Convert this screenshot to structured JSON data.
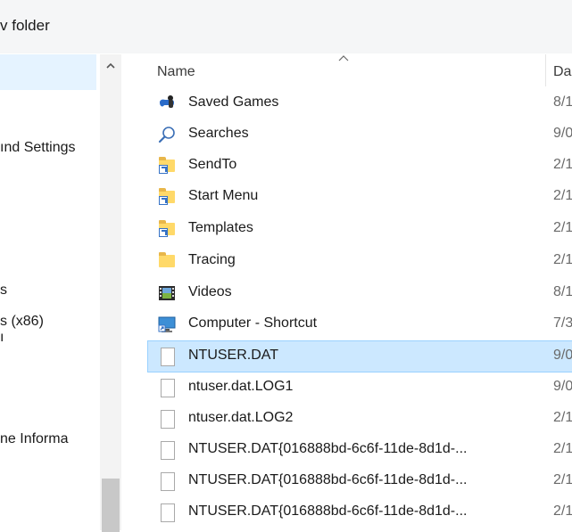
{
  "toolbar": {
    "new_folder": "v folder"
  },
  "nav": {
    "items": [
      {
        "label": ""
      },
      {
        "label": "ınd Settings"
      },
      {
        "label": "s"
      },
      {
        "label": "s (x86)"
      },
      {
        "label": "ı"
      },
      {
        "label": "ne Informa"
      }
    ]
  },
  "list": {
    "columns": {
      "name": "Name",
      "date": "Da"
    },
    "rows": [
      {
        "name": "Saved Games",
        "date": "8/1",
        "icon": "saved-games-icon"
      },
      {
        "name": "Searches",
        "date": "9/0",
        "icon": "search-icon"
      },
      {
        "name": "SendTo",
        "date": "2/1",
        "icon": "folder-shortcut-icon"
      },
      {
        "name": "Start Menu",
        "date": "2/1",
        "icon": "folder-shortcut-icon"
      },
      {
        "name": "Templates",
        "date": "2/1",
        "icon": "folder-shortcut-icon"
      },
      {
        "name": "Tracing",
        "date": "2/1",
        "icon": "folder-icon"
      },
      {
        "name": "Videos",
        "date": "8/1",
        "icon": "videos-icon"
      },
      {
        "name": "Computer - Shortcut",
        "date": "7/3",
        "icon": "computer-shortcut-icon"
      },
      {
        "name": "NTUSER.DAT",
        "date": "9/0",
        "icon": "file-icon",
        "selected": true
      },
      {
        "name": "ntuser.dat.LOG1",
        "date": "9/0",
        "icon": "file-icon"
      },
      {
        "name": "ntuser.dat.LOG2",
        "date": "2/1",
        "icon": "file-icon"
      },
      {
        "name": "NTUSER.DAT{016888bd-6c6f-11de-8d1d-...",
        "date": "2/1",
        "icon": "file-icon"
      },
      {
        "name": "NTUSER.DAT{016888bd-6c6f-11de-8d1d-...",
        "date": "2/1",
        "icon": "file-icon"
      },
      {
        "name": "NTUSER.DAT{016888bd-6c6f-11de-8d1d-...",
        "date": "2/1",
        "icon": "file-icon"
      }
    ]
  },
  "colors": {
    "selection": "#cce8ff",
    "nav_selection": "#e5f3ff",
    "folder": "#ffd969"
  }
}
